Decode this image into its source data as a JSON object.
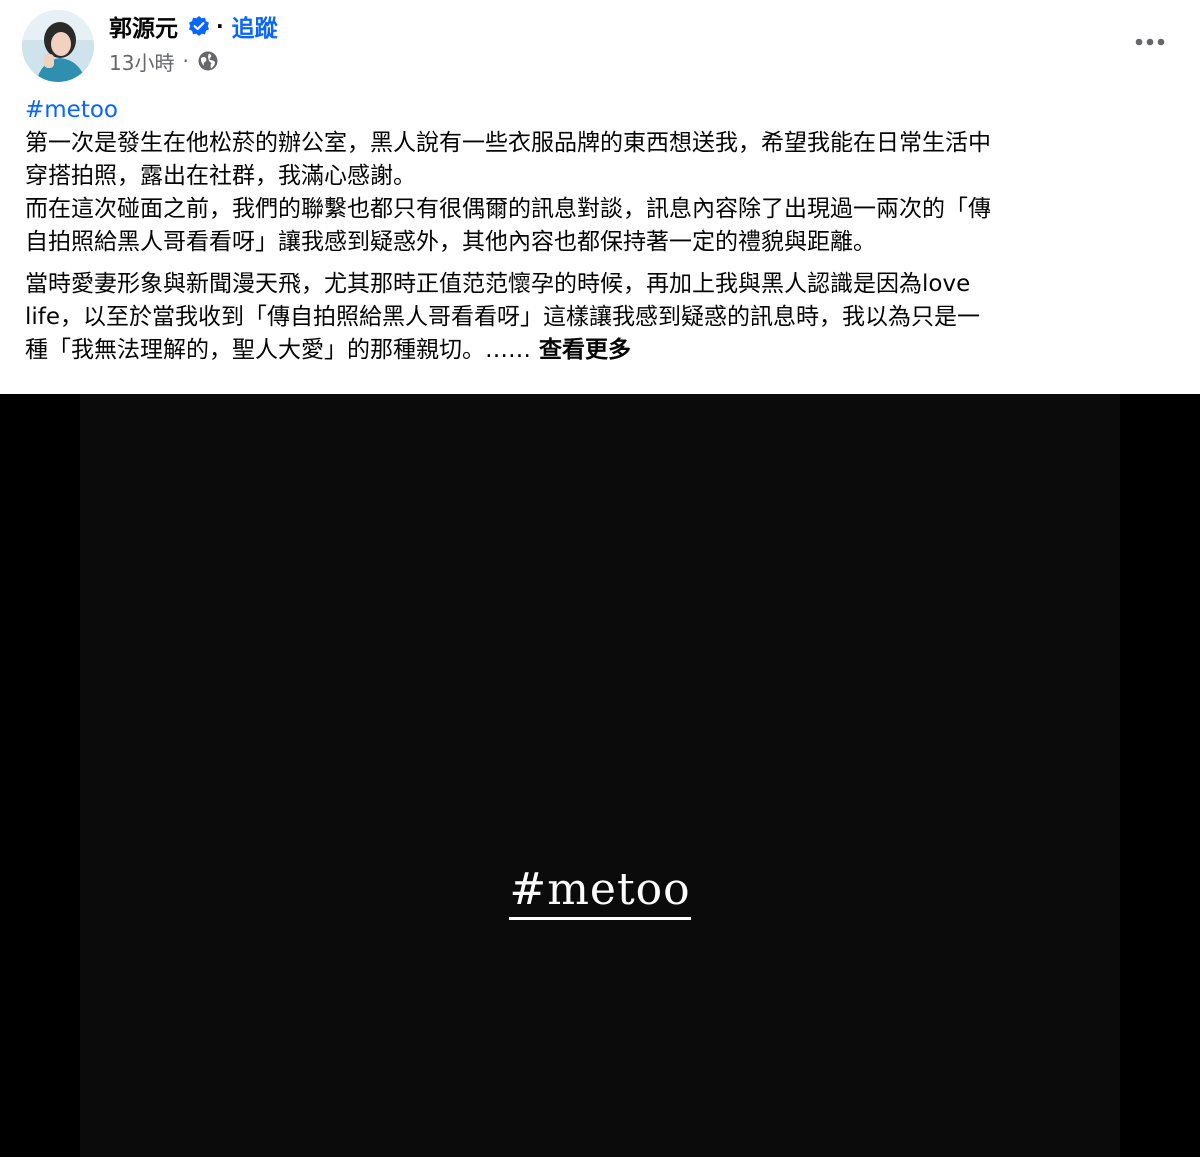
{
  "post": {
    "author": {
      "name": "郭源元",
      "verified_icon": "verified-badge-icon",
      "separator": "·",
      "follow_label": "追蹤"
    },
    "meta": {
      "time": "13小時",
      "separator": "·",
      "audience_icon": "globe-icon"
    },
    "more_icon": "more-options-icon",
    "body": {
      "hashtag": "#metoo",
      "paragraph1_lines": [
        "第一次是發生在他松菸的辦公室，黑人說有一些衣服品牌的東西想送我，希望我能在日常生活中",
        "穿搭拍照，露出在社群，我滿心感謝。",
        "而在這次碰面之前，我們的聯繫也都只有很偶爾的訊息對談，訊息內容除了出現過一兩次的「傳",
        "自拍照給黑人哥看看呀」讓我感到疑惑外，其他內容也都保持著一定的禮貌與距離。"
      ],
      "paragraph2_lines": [
        "當時愛妻形象與新聞漫天飛，尤其那時正值范范懷孕的時候，再加上我與黑人認識是因為love",
        "life，以至於當我收到「傳自拍照給黑人哥看看呀」這樣讓我感到疑惑的訊息時，我以為只是一",
        "種「我無法理解的，聖人大愛」的那種親切。……"
      ],
      "see_more_label": "查看更多"
    },
    "media": {
      "text": "#metoo"
    }
  },
  "colors": {
    "link": "#0866ff",
    "text": "#050505",
    "secondary": "#65676b",
    "media_bg": "#000000"
  }
}
